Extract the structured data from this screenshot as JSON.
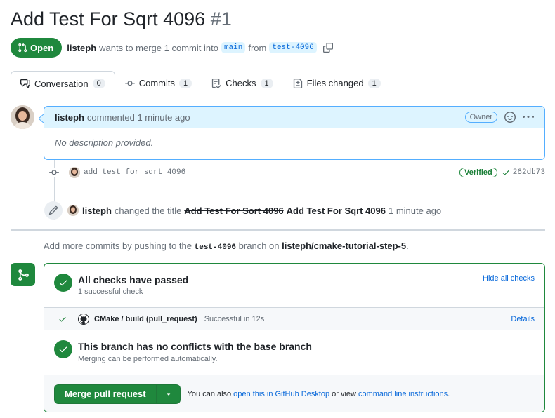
{
  "pr": {
    "title": "Add Test For Sqrt 4096",
    "number": "#1",
    "state": "Open",
    "author": "listeph",
    "merge_text_1": "wants to merge 1 commit into",
    "base_branch": "main",
    "merge_text_2": "from",
    "head_branch": "test-4096"
  },
  "tabs": [
    {
      "label": "Conversation",
      "count": "0",
      "icon": "comment-discussion-icon"
    },
    {
      "label": "Commits",
      "count": "1",
      "icon": "git-commit-icon"
    },
    {
      "label": "Checks",
      "count": "1",
      "icon": "checklist-icon"
    },
    {
      "label": "Files changed",
      "count": "1",
      "icon": "file-diff-icon"
    }
  ],
  "comment": {
    "author": "listeph",
    "action": "commented 1 minute ago",
    "role": "Owner",
    "body": "No description provided."
  },
  "commit": {
    "message": "add test for sqrt 4096",
    "verified": "Verified",
    "sha": "262db73"
  },
  "rename_event": {
    "author": "listeph",
    "action": "changed the title",
    "old_title": "Add Test For Sort 4096",
    "new_title": "Add Test For Sqrt 4096",
    "time": "1 minute ago"
  },
  "push_hint": {
    "prefix": "Add more commits by pushing to the",
    "branch": "test-4096",
    "middle": "branch on",
    "repo": "listeph/cmake-tutorial-step-5",
    "suffix": "."
  },
  "checks": {
    "title": "All checks have passed",
    "subtitle": "1 successful check",
    "hide_link": "Hide all checks",
    "items": [
      {
        "name": "CMake / build (pull_request)",
        "status": "Successful in 12s",
        "details": "Details"
      }
    ]
  },
  "conflicts": {
    "title": "This branch has no conflicts with the base branch",
    "subtitle": "Merging can be performed automatically."
  },
  "merge": {
    "button": "Merge pull request",
    "hint_1": "You can also",
    "link_1": "open this in GitHub Desktop",
    "hint_2": "or view",
    "link_2": "command line instructions",
    "hint_3": "."
  },
  "colors": {
    "green": "#1f883d",
    "blue_link": "#0969da",
    "blue_header": "#ddf4ff",
    "border": "#d0d7de"
  }
}
